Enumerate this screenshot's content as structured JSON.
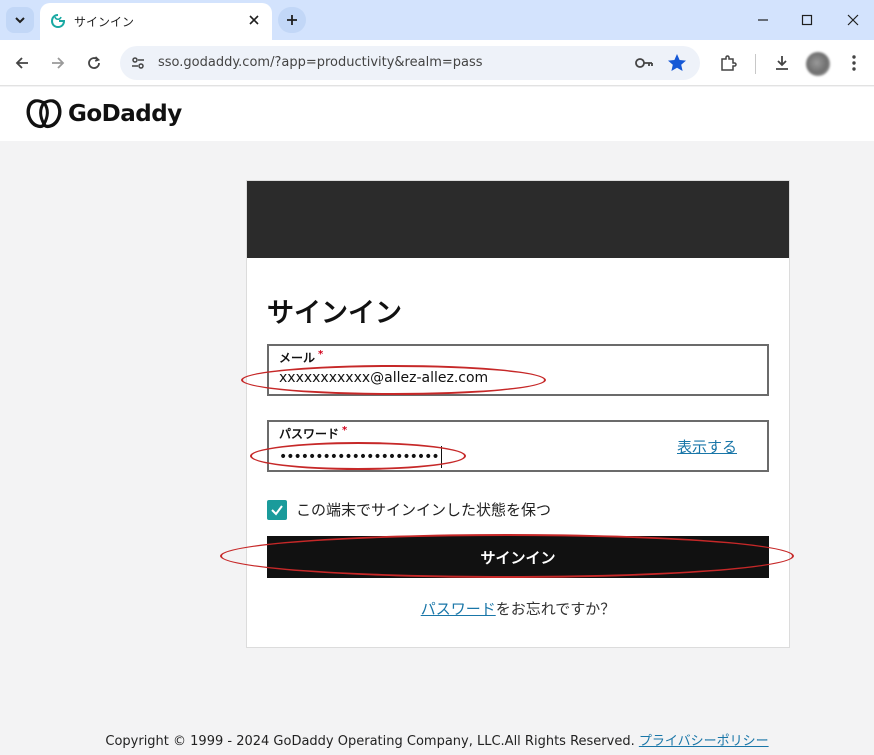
{
  "browser": {
    "tab_title": "サインイン",
    "url": "sso.godaddy.com/?app=productivity&realm=pass"
  },
  "header": {
    "logo_text": "GoDaddy"
  },
  "signin": {
    "title": "サインイン",
    "email": {
      "label": "メール",
      "required_mark": "*",
      "value": "xxxxxxxxxxx@allez-allez.com"
    },
    "password": {
      "label": "パスワード",
      "required_mark": "*",
      "value": "••••••••••••••••••••••",
      "show_label": "表示する"
    },
    "remember": {
      "label": "この端末でサインインした状態を保つ",
      "checked": true
    },
    "submit_label": "サインイン",
    "forgot": {
      "link": "パスワード",
      "suffix": "をお忘れですか？"
    }
  },
  "footer": {
    "copyright": "Copyright © 1999 - 2024 GoDaddy Operating Company, LLC.All Rights Reserved.",
    "privacy_link": "プライバシーポリシー"
  },
  "colors": {
    "accent": "#1a9b9b",
    "link": "#1976a8",
    "annotation": "#c62828",
    "button": "#111111"
  }
}
